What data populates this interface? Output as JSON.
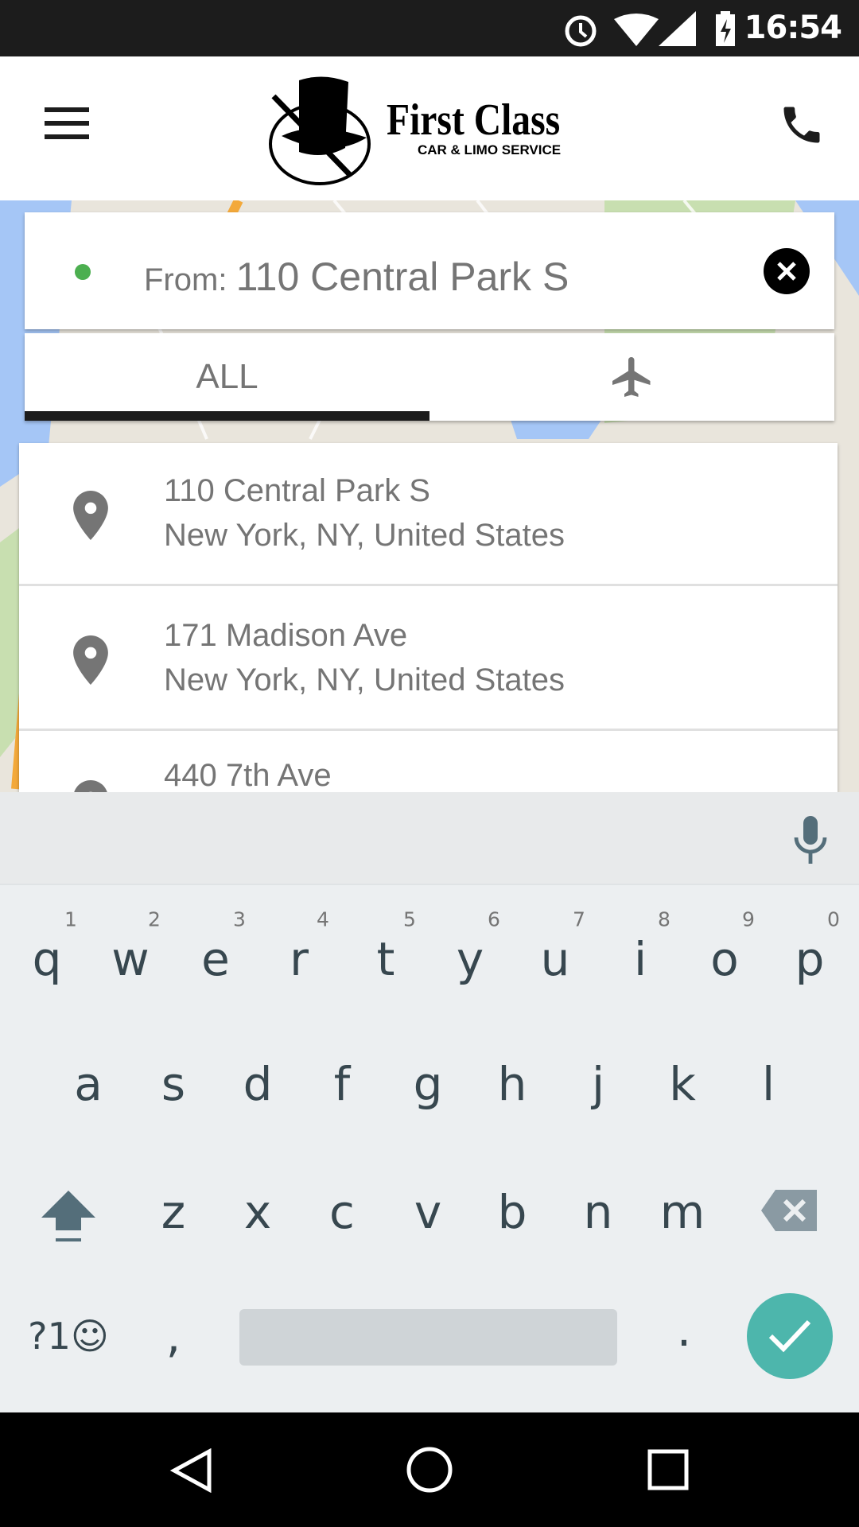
{
  "status_bar": {
    "time": "16:54",
    "icons": [
      "alarm-icon",
      "wifi-icon",
      "signal-icon",
      "battery-charging-icon"
    ]
  },
  "header": {
    "logo_title": "First Class",
    "logo_subtitle": "CAR & LIMO SERVICE",
    "menu_icon": "hamburger-icon",
    "call_icon": "phone-icon"
  },
  "search": {
    "label": "From:",
    "value": "110 Central Park S",
    "dot_color": "#4caf50"
  },
  "tabs": [
    {
      "label": "ALL",
      "active": true
    },
    {
      "icon": "airplane-icon",
      "active": false
    }
  ],
  "results": [
    {
      "line1": "110 Central Park S",
      "line2": "New York, NY, United States"
    },
    {
      "line1": "171 Madison Ave",
      "line2": "New York, NY, United States"
    },
    {
      "line1": "440 7th Ave",
      "line2": ""
    }
  ],
  "keyboard": {
    "row1": [
      "q",
      "w",
      "e",
      "r",
      "t",
      "y",
      "u",
      "i",
      "o",
      "p"
    ],
    "row1_hints": [
      "1",
      "2",
      "3",
      "4",
      "5",
      "6",
      "7",
      "8",
      "9",
      "0"
    ],
    "row2": [
      "a",
      "s",
      "d",
      "f",
      "g",
      "h",
      "j",
      "k",
      "l"
    ],
    "row3": [
      "z",
      "x",
      "c",
      "v",
      "b",
      "n",
      "m"
    ],
    "symbols": "?1☺",
    "comma": ",",
    "period": ".",
    "accent": "#4db6ac"
  }
}
